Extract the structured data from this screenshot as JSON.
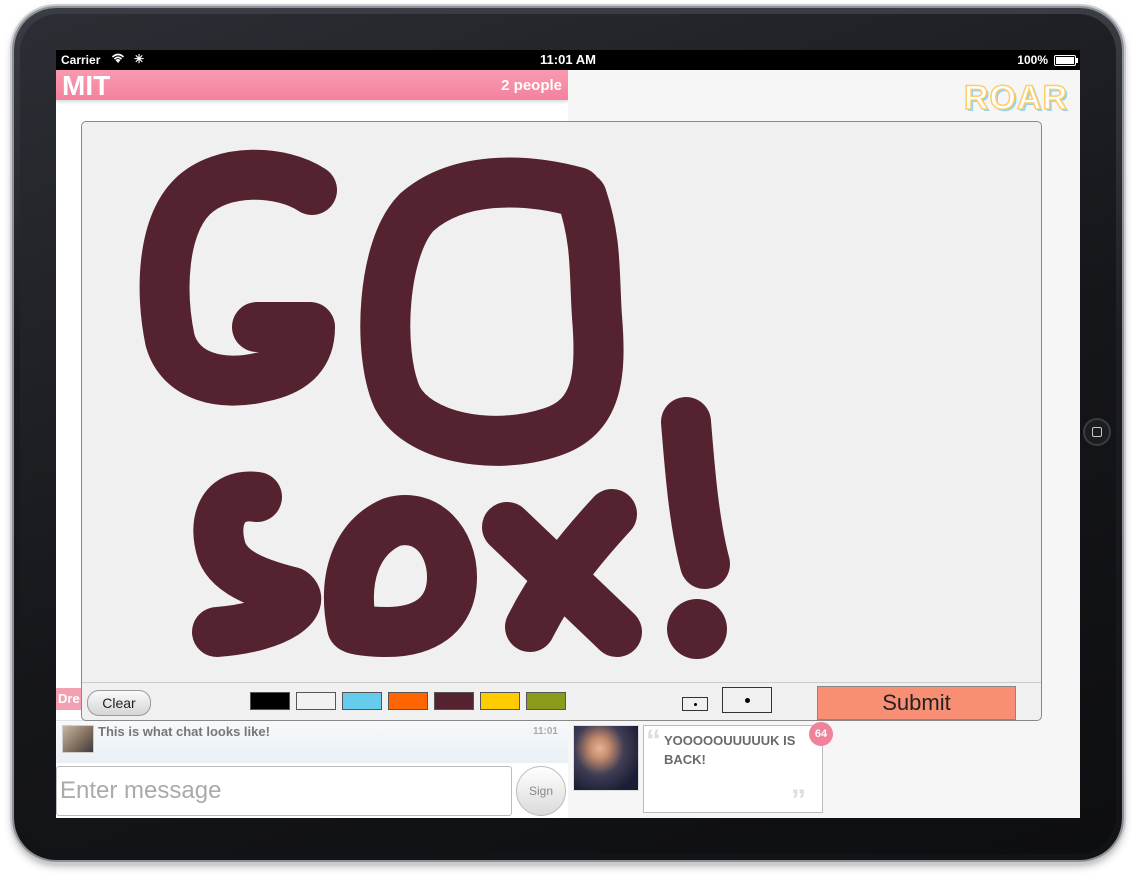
{
  "status_bar": {
    "carrier": "Carrier",
    "time": "11:01 AM",
    "battery": "100%",
    "battery_level": 1.0
  },
  "room": {
    "title": "MIT",
    "people_count": "2 people",
    "side_tab_label": "Dre"
  },
  "app": {
    "logo_text": "ROAR"
  },
  "chat": {
    "message": "This is what chat looks like!",
    "time": "11:01"
  },
  "composer": {
    "placeholder": "Enter message",
    "sign_label": "Sign"
  },
  "feed": {
    "quote": "YOOOOOUUUUUK IS BACK!",
    "badge_count": "64"
  },
  "drawing": {
    "clear_label": "Clear",
    "submit_label": "Submit",
    "selected_color": "#55222f",
    "palette": [
      "#000000",
      "#f2f2f2",
      "#66ccee",
      "#ff6600",
      "#55222f",
      "#ffcc00",
      "#8a9a1a"
    ],
    "brush_sizes": [
      "small",
      "medium"
    ]
  }
}
